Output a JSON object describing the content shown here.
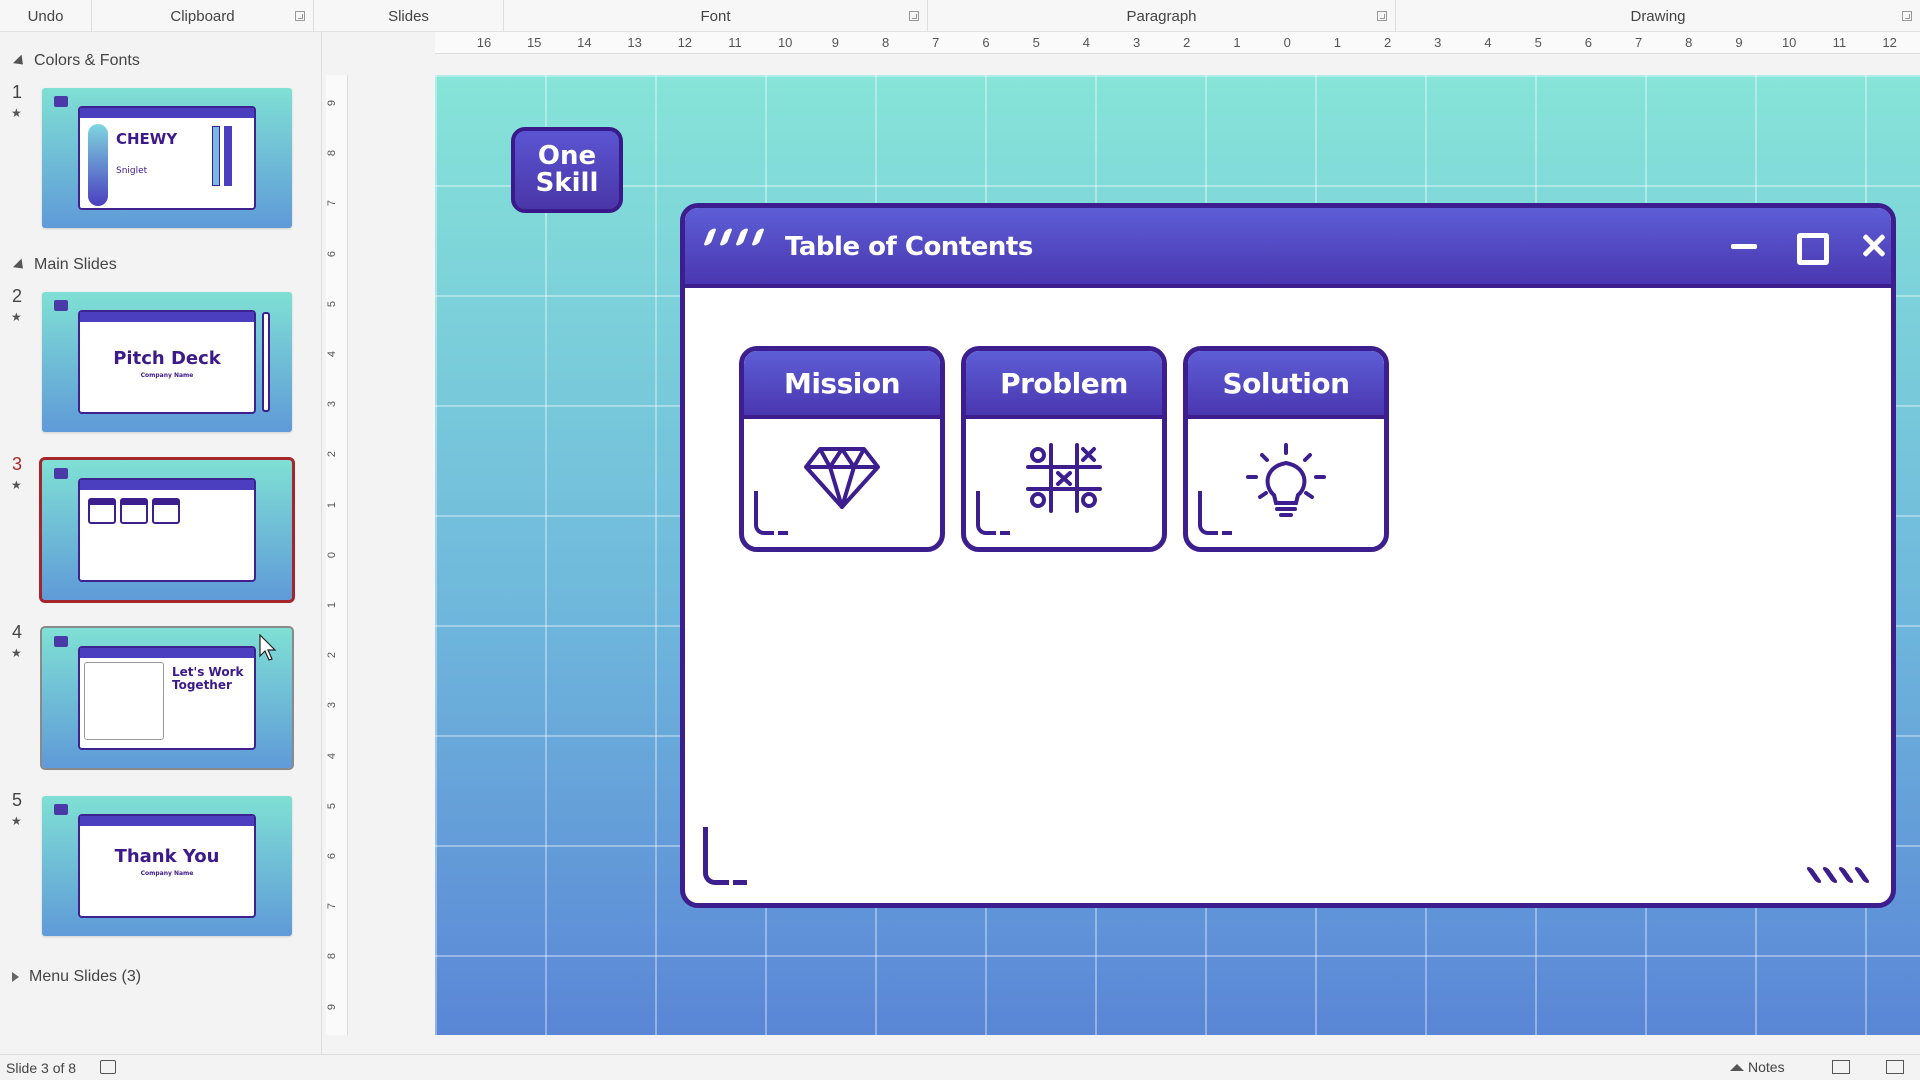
{
  "ribbon": {
    "groups": [
      {
        "label": "Undo"
      },
      {
        "label": "Clipboard"
      },
      {
        "label": "Slides"
      },
      {
        "label": "Font"
      },
      {
        "label": "Paragraph"
      },
      {
        "label": "Drawing"
      }
    ]
  },
  "thumbnails_pane": {
    "sections": [
      {
        "label": "Colors & Fonts"
      },
      {
        "label": "Main Slides"
      },
      {
        "label": "Menu Slides (3)"
      }
    ],
    "slides": [
      {
        "number": "1",
        "star": "★",
        "title": "CHEWY",
        "subtitle": "Sniglet"
      },
      {
        "number": "2",
        "star": "★",
        "title": "Pitch Deck",
        "subtitle": "Company Name"
      },
      {
        "number": "3",
        "star": "★",
        "title": "Table of Contents",
        "subtitle": ""
      },
      {
        "number": "4",
        "star": "★",
        "title": "Let's Work Together",
        "subtitle": ""
      },
      {
        "number": "5",
        "star": "★",
        "title": "Thank You",
        "subtitle": "Company Name"
      }
    ]
  },
  "ruler": {
    "horizontal": [
      "16",
      "15",
      "14",
      "13",
      "12",
      "11",
      "10",
      "9",
      "8",
      "7",
      "6",
      "5",
      "4",
      "3",
      "2",
      "1",
      "0",
      "1",
      "2",
      "3",
      "4",
      "5",
      "6",
      "7",
      "8",
      "9",
      "10",
      "11",
      "12"
    ],
    "vertical": [
      "9",
      "8",
      "7",
      "6",
      "5",
      "4",
      "3",
      "2",
      "1",
      "0",
      "1",
      "2",
      "3",
      "4",
      "5",
      "6",
      "7",
      "8",
      "9"
    ]
  },
  "slide": {
    "logo_line1": "One",
    "logo_line2": "Skill",
    "window_title": "Table of Contents",
    "cards": [
      {
        "label": "Mission",
        "icon": "diamond-icon"
      },
      {
        "label": "Problem",
        "icon": "tic-tac-toe-icon"
      },
      {
        "label": "Solution",
        "icon": "lightbulb-icon"
      }
    ]
  },
  "status_bar": {
    "slide_position": "Slide 3 of 8",
    "notes_label": "Notes"
  },
  "colors": {
    "accent_purple": "#3d1e8f",
    "titlebar_blue": "#4a37b0",
    "background_teal": "#86e4d8",
    "background_blue": "#5a86d6",
    "selection_red": "#a4262c"
  }
}
